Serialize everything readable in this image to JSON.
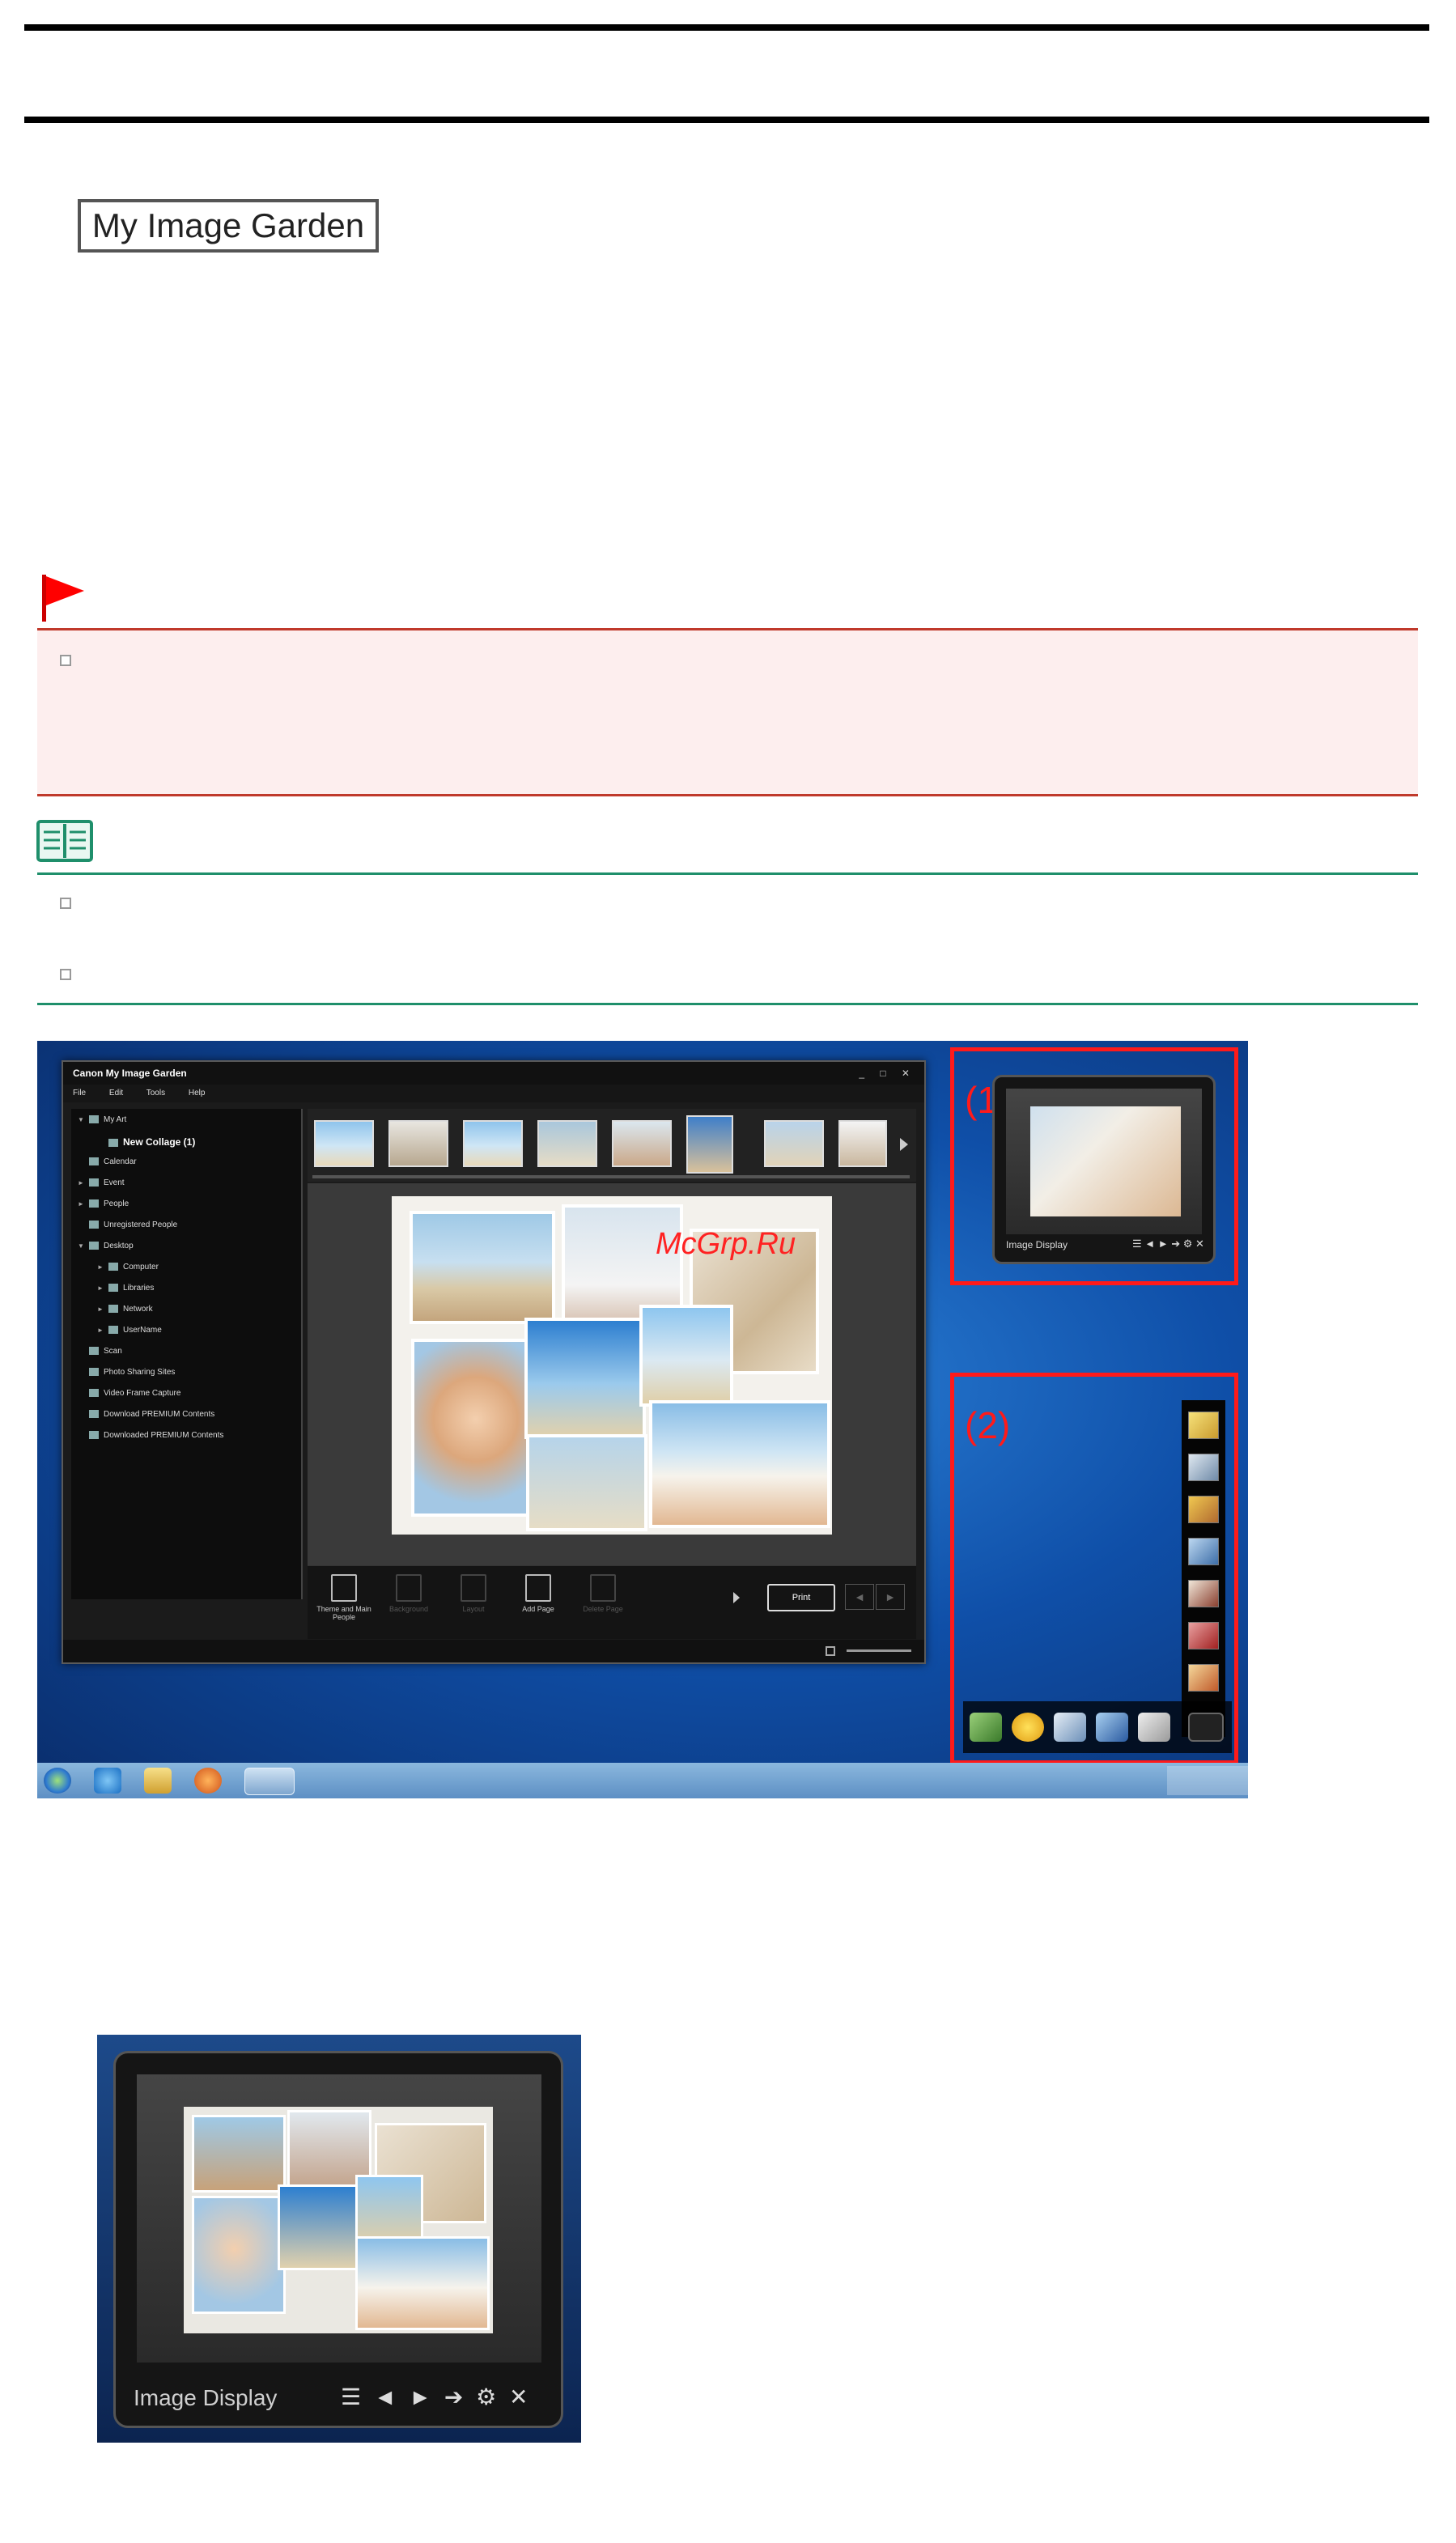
{
  "brand_tag": "My Image Garden",
  "screenshot": {
    "window_title": "Canon My Image Garden",
    "window_controls": "_ □ ✕",
    "menu": [
      "File",
      "Edit",
      "Tools",
      "Help"
    ],
    "tree": [
      {
        "label": "My Art",
        "indent": 0,
        "arrow": "▼"
      },
      {
        "label": "New Collage (1)",
        "indent": 1,
        "arrow": ""
      },
      {
        "label": "Calendar",
        "indent": 0,
        "arrow": ""
      },
      {
        "label": "Event",
        "indent": 0,
        "arrow": "►"
      },
      {
        "label": "People",
        "indent": 0,
        "arrow": "►"
      },
      {
        "label": "Unregistered People",
        "indent": 0,
        "arrow": ""
      },
      {
        "label": "Desktop",
        "indent": 0,
        "arrow": "▼"
      },
      {
        "label": "Computer",
        "indent": 1,
        "arrow": "►"
      },
      {
        "label": "Libraries",
        "indent": 1,
        "arrow": "►"
      },
      {
        "label": "Network",
        "indent": 1,
        "arrow": "►"
      },
      {
        "label": "UserName",
        "indent": 1,
        "arrow": "►"
      },
      {
        "label": "Scan",
        "indent": 0,
        "arrow": ""
      },
      {
        "label": "Photo Sharing Sites",
        "indent": 0,
        "arrow": ""
      },
      {
        "label": "Video Frame Capture",
        "indent": 0,
        "arrow": ""
      },
      {
        "label": "Download PREMIUM Contents",
        "indent": 0,
        "arrow": ""
      },
      {
        "label": "Downloaded PREMIUM Contents",
        "indent": 0,
        "arrow": ""
      }
    ],
    "toolbar": {
      "theme": "Theme and Main People",
      "background": "Background",
      "layout": "Layout",
      "add_page": "Add Page",
      "delete_page": "Delete Page",
      "print": "Print"
    },
    "watermark": "McGrp.Ru",
    "callout_1": "(1)",
    "callout_2": "(2)",
    "gadget_label": "Image Display"
  },
  "enlarged_gadget": {
    "label": "Image Display",
    "controls": "☰ ◄ ► ➔ ⚙ ✕"
  },
  "colors": {
    "important_accent": "#c0392b",
    "note_accent": "#1f8f6b",
    "callout_red": "#ff1a1a"
  }
}
